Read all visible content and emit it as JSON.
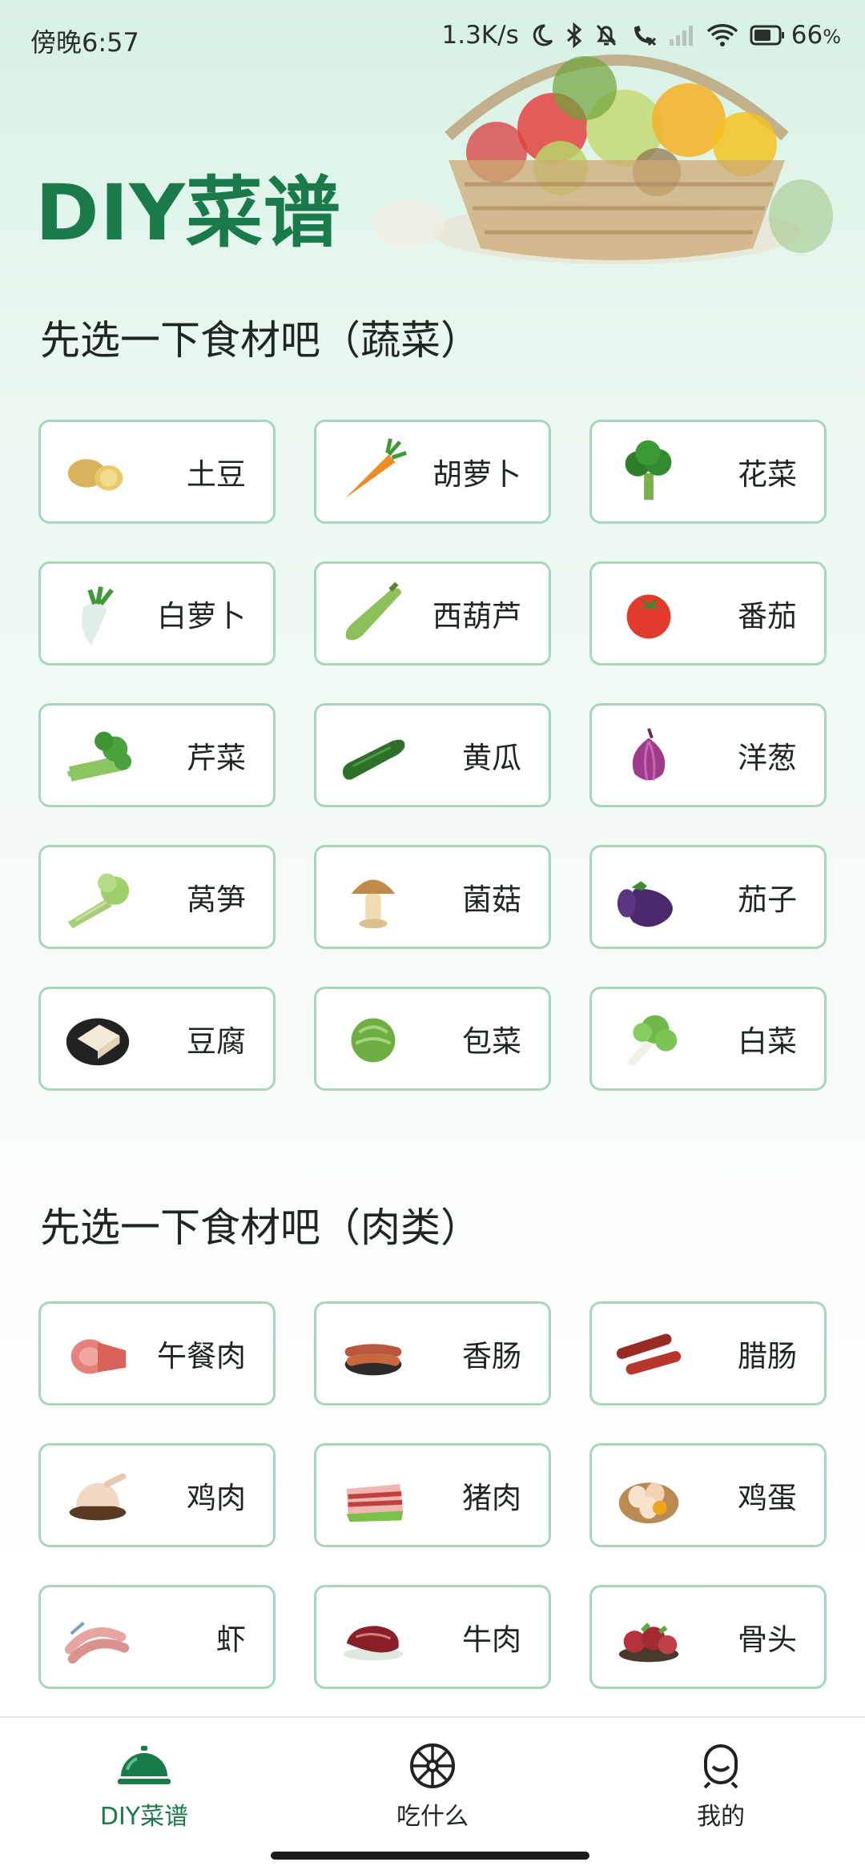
{
  "status_bar": {
    "time": "傍晚6:57",
    "network_speed": "1.3K/s",
    "battery": "66",
    "battery_unit": "%"
  },
  "app": {
    "title": "DIY菜谱"
  },
  "sections": {
    "vegetables": {
      "title": "先选一下食材吧（蔬菜）",
      "items": [
        {
          "label": "土豆",
          "icon": "potato-icon"
        },
        {
          "label": "胡萝卜",
          "icon": "carrot-icon"
        },
        {
          "label": "花菜",
          "icon": "broccoli-icon"
        },
        {
          "label": "白萝卜",
          "icon": "white-radish-icon"
        },
        {
          "label": "西葫芦",
          "icon": "zucchini-icon"
        },
        {
          "label": "番茄",
          "icon": "tomato-icon"
        },
        {
          "label": "芹菜",
          "icon": "celery-icon"
        },
        {
          "label": "黄瓜",
          "icon": "cucumber-icon"
        },
        {
          "label": "洋葱",
          "icon": "onion-icon"
        },
        {
          "label": "莴笋",
          "icon": "lettuce-stem-icon"
        },
        {
          "label": "菌菇",
          "icon": "mushroom-icon"
        },
        {
          "label": "茄子",
          "icon": "eggplant-icon"
        },
        {
          "label": "豆腐",
          "icon": "tofu-icon"
        },
        {
          "label": "包菜",
          "icon": "cabbage-icon"
        },
        {
          "label": "白菜",
          "icon": "bok-choy-icon"
        }
      ]
    },
    "meat": {
      "title": "先选一下食材吧（肉类）",
      "items": [
        {
          "label": "午餐肉",
          "icon": "luncheon-meat-icon"
        },
        {
          "label": "香肠",
          "icon": "sausage-icon"
        },
        {
          "label": "腊肠",
          "icon": "chinese-sausage-icon"
        },
        {
          "label": "鸡肉",
          "icon": "chicken-icon"
        },
        {
          "label": "猪肉",
          "icon": "pork-icon"
        },
        {
          "label": "鸡蛋",
          "icon": "egg-icon"
        },
        {
          "label": "虾",
          "icon": "shrimp-icon"
        },
        {
          "label": "牛肉",
          "icon": "beef-icon"
        },
        {
          "label": "骨头",
          "icon": "bone-icon"
        }
      ]
    }
  },
  "bottom_nav": [
    {
      "label": "DIY菜谱",
      "icon": "cloche-icon",
      "active": true
    },
    {
      "label": "吃什么",
      "icon": "wheel-icon",
      "active": false
    },
    {
      "label": "我的",
      "icon": "profile-icon",
      "active": false
    }
  ],
  "colors": {
    "accent": "#1a7a4a",
    "card_border": "#a9d5bd"
  }
}
